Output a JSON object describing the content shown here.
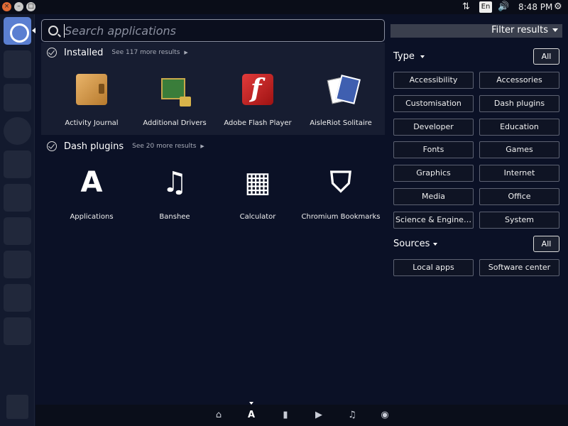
{
  "panel": {
    "close_glyph": "×",
    "minimize_glyph": "–",
    "maximize_glyph": "□",
    "keyboard_layout": "En",
    "clock": "8:48 PM",
    "network_glyph": "⇅",
    "volume_glyph": "🔊",
    "settings_glyph": "⚙"
  },
  "search": {
    "placeholder": "Search applications"
  },
  "installed": {
    "title": "Installed",
    "see_more": "See 117 more results",
    "apps": [
      {
        "label": "Activity Journal",
        "icon": "journal-icon"
      },
      {
        "label": "Additional Drivers",
        "icon": "drivers-icon"
      },
      {
        "label": "Adobe Flash Player",
        "icon": "flash-icon"
      },
      {
        "label": "AisleRiot Solitaire",
        "icon": "cards-icon"
      }
    ]
  },
  "dash_plugins": {
    "title": "Dash plugins",
    "see_more": "See 20 more results",
    "plugins": [
      {
        "label": "Applications",
        "glyph": "A"
      },
      {
        "label": "Banshee",
        "glyph": "♫"
      },
      {
        "label": "Calculator",
        "glyph": "▦"
      },
      {
        "label": "Chromium Bookmarks",
        "glyph": "⛉"
      }
    ]
  },
  "filter": {
    "title": "Filter results",
    "type_label": "Type",
    "all_label": "All",
    "types": [
      "Accessibility",
      "Accessories",
      "Customisation",
      "Dash plugins",
      "Developer",
      "Education",
      "Fonts",
      "Games",
      "Graphics",
      "Internet",
      "Media",
      "Office",
      "Science & Engine…",
      "System"
    ],
    "sources_label": "Sources",
    "sources": [
      "Local apps",
      "Software center"
    ]
  },
  "lenses": {
    "home": "⌂",
    "applications": "A",
    "files": "▮",
    "video": "▶",
    "music": "♫",
    "photos": "◉"
  },
  "colors": {
    "background": "#0b1126",
    "launcher_home": "#5b7fd1",
    "close_button": "#e06a35"
  }
}
